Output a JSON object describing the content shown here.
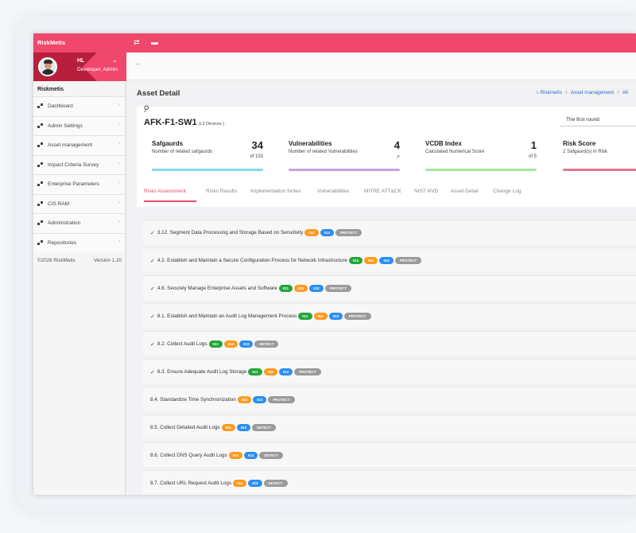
{
  "app": {
    "brand": "RiskMetis"
  },
  "topbar": {
    "icons": [
      "shuffle-icon",
      "card-icon"
    ]
  },
  "user": {
    "initials": "HL",
    "role": "Developer, Admin"
  },
  "sidebar": {
    "title": "Riskmetis",
    "items": [
      {
        "label": "Dashboard"
      },
      {
        "label": "Admin Settings"
      },
      {
        "label": "Asset management"
      },
      {
        "label": "Impact Criteria Survey"
      },
      {
        "label": "Enterprise Parameters"
      },
      {
        "label": "CIS RAM"
      },
      {
        "label": "Administration"
      },
      {
        "label": "Repositories"
      }
    ],
    "footer": {
      "copyright": "©2026 RiskMetis",
      "version": "Version 1.20"
    }
  },
  "subbar": {
    "text": "–"
  },
  "page": {
    "title": "Asset Detail",
    "breadcrumb": [
      "Riskmetis",
      "Asset management",
      "All"
    ]
  },
  "asset": {
    "name": "AFK-F1-SW1",
    "devices": "(L2 Devices )",
    "round": "The first round"
  },
  "stats": [
    {
      "title": "Safgaurds",
      "subtitle": "Number of related safgaurds",
      "value": "34",
      "of": "of 153",
      "color": "#7fd8ef"
    },
    {
      "title": "Vulnerabilities",
      "subtitle": "Number of related Vulnerabilities",
      "value": "4",
      "of": "↗",
      "color": "#c2a3e0"
    },
    {
      "title": "VCDB Index",
      "subtitle": "Calculated Numerical Score",
      "value": "1",
      "of": "of 5",
      "color": "#a6e6a0"
    },
    {
      "title": "Risk Score",
      "subtitle": "2 Safgaurd(s) in Risk",
      "value": "",
      "of": "",
      "color": "#e8748c"
    }
  ],
  "tabs": [
    {
      "label": "Risks Assessment",
      "active": true
    },
    {
      "label": "Risks Results"
    },
    {
      "label": "Implementation Notes"
    },
    {
      "label": "Vulnerabilities"
    },
    {
      "label": "MITRE ATT&CK"
    },
    {
      "label": "NIST NVD"
    },
    {
      "label": "Asset Detail"
    },
    {
      "label": "Change Log"
    }
  ],
  "safeguards": [
    {
      "checked": true,
      "text": "3.12. Segment Data Processing and Storage Based on Sensitivity",
      "badges": [
        "IG2",
        "IG3"
      ],
      "function": "PROTECT"
    },
    {
      "checked": true,
      "text": "4.2. Establish and Maintain a Secure Configuration Process for Network Infrastructure",
      "badges": [
        "IG1",
        "IG2",
        "IG3"
      ],
      "function": "PROTECT"
    },
    {
      "checked": true,
      "text": "4.6. Securely Manage Enterprise Assets and Software",
      "badges": [
        "IG1",
        "IG2",
        "IG3"
      ],
      "function": "PROTECT"
    },
    {
      "checked": true,
      "text": "8.1. Establish and Maintain an Audit Log Management Process",
      "badges": [
        "IG1",
        "IG2",
        "IG3"
      ],
      "function": "PROTECT"
    },
    {
      "checked": true,
      "text": "8.2. Collect Audit Logs",
      "badges": [
        "IG1",
        "IG2",
        "IG3"
      ],
      "function": "DETECT"
    },
    {
      "checked": true,
      "text": "8.3. Ensure Adequate Audit Log Storage",
      "badges": [
        "IG1",
        "IG2",
        "IG3"
      ],
      "function": "PROTECT"
    },
    {
      "checked": false,
      "text": "8.4. Standardize Time Synchronization",
      "badges": [
        "IG2",
        "IG3"
      ],
      "function": "PROTECT"
    },
    {
      "checked": false,
      "text": "8.5. Collect Detailed Audit Logs",
      "badges": [
        "IG2",
        "IG3"
      ],
      "function": "DETECT"
    },
    {
      "checked": false,
      "text": "8.6. Collect DNS Query Audit Logs",
      "badges": [
        "IG2",
        "IG3"
      ],
      "function": "DETECT"
    },
    {
      "checked": false,
      "text": "8.7. Collect URL Request Audit Logs",
      "badges": [
        "IG2",
        "IG3"
      ],
      "function": "DETECT"
    }
  ]
}
